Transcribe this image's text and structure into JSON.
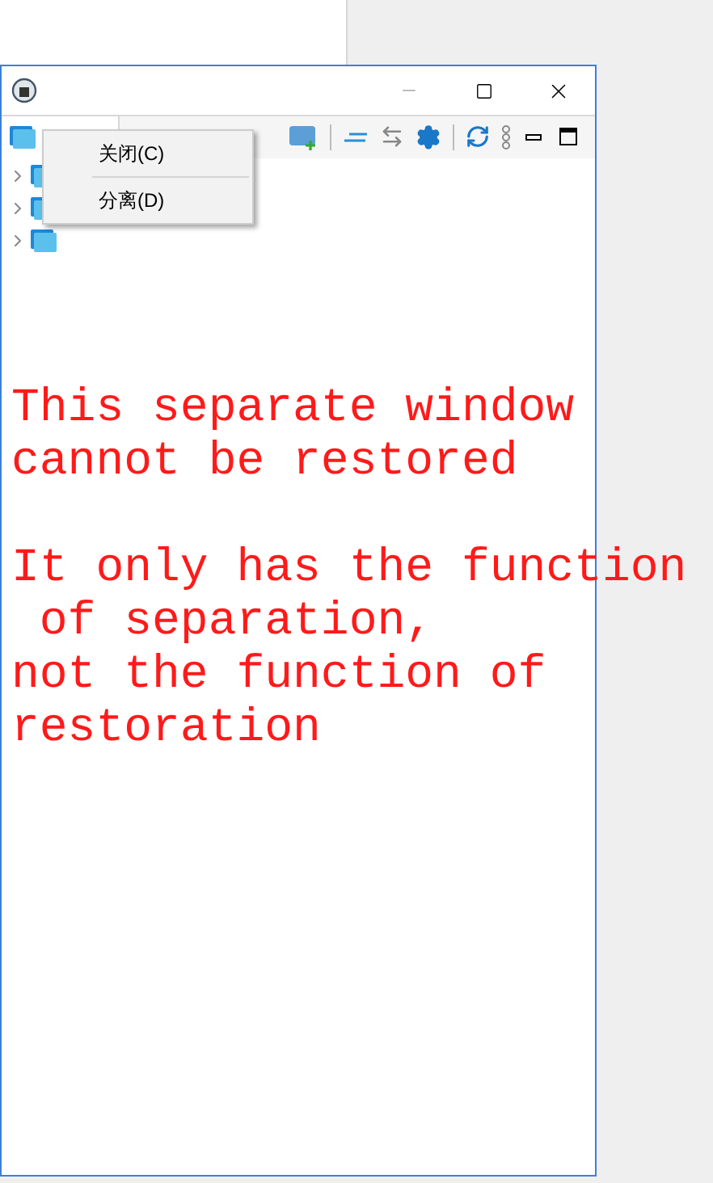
{
  "context_menu": {
    "items": [
      {
        "label": "关闭(C)"
      },
      {
        "label": "分离(D)"
      }
    ]
  },
  "tree": {
    "items": [
      {
        "expanded": false
      },
      {
        "expanded": false
      },
      {
        "expanded": false
      }
    ]
  },
  "annotation": {
    "paragraphs": [
      [
        "This separate window",
        "cannot be restored"
      ],
      [
        "It only has the function",
        " of separation,",
        "not the function of",
        "restoration"
      ]
    ]
  }
}
